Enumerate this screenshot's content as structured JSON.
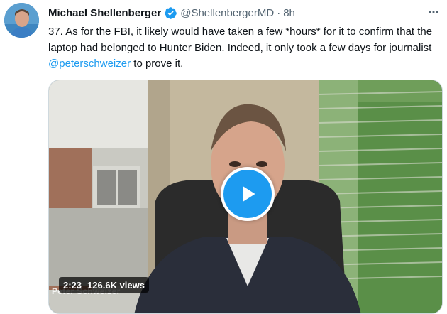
{
  "tweet": {
    "author_name": "Michael Shellenberger",
    "handle": "@ShellenbergerMD",
    "separator": "·",
    "time": "8h",
    "text_before": "37. As for the FBI, it likely would have taken a few *hours* for it to confirm that the laptop had belonged to Hunter Biden. Indeed, it only took a few days for journalist ",
    "mention": "@peterschweizer",
    "text_after": " to prove it."
  },
  "video": {
    "duration": "2:23",
    "views": "126.6K views",
    "caption": "Peter Schweizer"
  },
  "icons": {
    "verified": "verified-badge-icon",
    "more": "more-icon",
    "play": "play-icon"
  },
  "colors": {
    "accent": "#1d9bf0",
    "secondary_text": "#536471"
  }
}
